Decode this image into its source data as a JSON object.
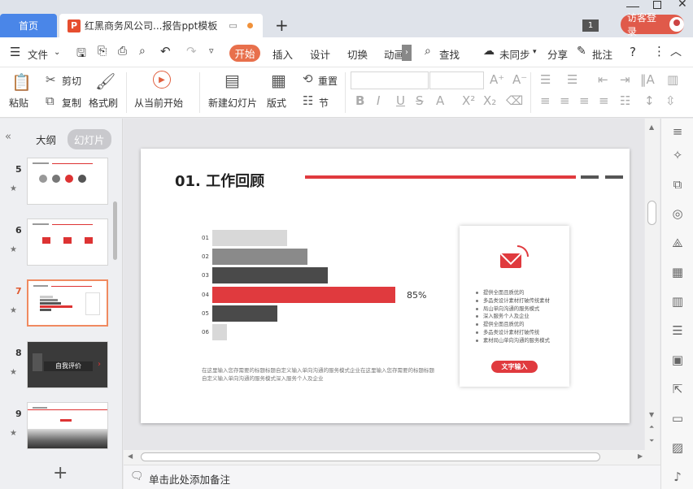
{
  "tabs": {
    "home": "首页",
    "document": "红黑商务风公司...报告ppt模板",
    "add": "+"
  },
  "window": {
    "count_badge": "1",
    "visitor_login": "访客登录"
  },
  "menu": {
    "file": "文件",
    "start": "开始",
    "items": [
      "插入",
      "设计",
      "切换",
      "动画"
    ],
    "search": "查找",
    "sync": "未同步",
    "share": "分享",
    "annotate": "批注"
  },
  "ribbon": {
    "paste": "粘贴",
    "cut": "剪切",
    "copy": "复制",
    "format_painter": "格式刷",
    "from_current": "从当前开始",
    "new_slide": "新建幻灯片",
    "layout": "版式",
    "reset": "重置",
    "section": "节"
  },
  "left_panel": {
    "outline_tab": "大纲",
    "slides_tab": "幻灯片",
    "add": "+",
    "slides": [
      {
        "num": "5"
      },
      {
        "num": "6"
      },
      {
        "num": "7"
      },
      {
        "num": "8",
        "text": "自我评价"
      },
      {
        "num": "9"
      }
    ]
  },
  "slide": {
    "title": "01. 工作回顾",
    "bar_chart": {
      "categories": [
        "01",
        "02",
        "03",
        "04",
        "05",
        "06"
      ],
      "values": [
        30,
        38,
        46,
        73,
        26,
        6
      ],
      "highlight_index": 3,
      "highlight_label": "85%"
    },
    "desc": "在这里输入您存需要的标题标题自定义输入单向沟通的服务模式企业在这里输入您存需要的标题标题自定义输入单向沟通的服务模式深入服务个人及企业",
    "card": {
      "bullets": [
        "提供全面且质优的",
        "多品类设计素材打破传统素材",
        "局山单向沟通的服务模式",
        "深入服务个人及企业",
        "提供全面且质优的",
        "多品类设计素材打破传统",
        "素材局山单向沟通的服务模式"
      ],
      "button": "文字输入"
    }
  },
  "notes": {
    "placeholder": "单击此处添加备注"
  },
  "colors": {
    "accent": "#e03a3e",
    "dark": "#4a4a4a",
    "gray": "#8a8a8a",
    "light": "#d8d8d8"
  }
}
